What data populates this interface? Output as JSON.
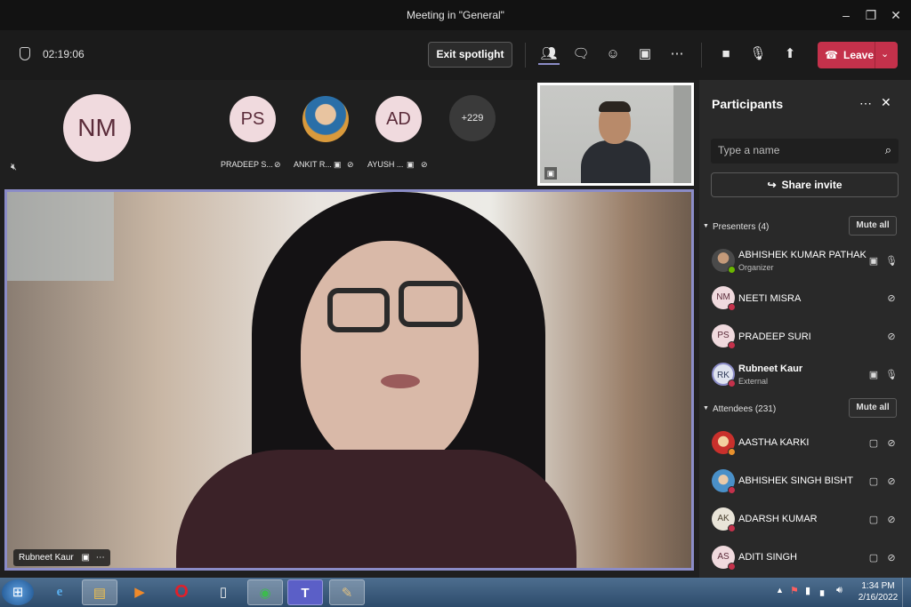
{
  "window": {
    "title": "Meeting in \"General\""
  },
  "toolbar": {
    "timer": "02:19:06",
    "exit_spotlight": "Exit spotlight",
    "leave": "Leave"
  },
  "stage": {
    "tiles": [
      {
        "initials": "NM",
        "name": ""
      },
      {
        "initials": "PS",
        "name": "PRADEEP S..."
      },
      {
        "initials": "",
        "name": "ANKIT R..."
      },
      {
        "initials": "AD",
        "name": "AYUSH ..."
      }
    ],
    "overflow": "+229",
    "spotlight_name": "Rubneet Kaur"
  },
  "panel": {
    "title": "Participants",
    "search_placeholder": "Type a name",
    "share_invite": "Share invite",
    "presenters_label": "Presenters (4)",
    "attendees_label": "Attendees (231)",
    "mute_all": "Mute all",
    "presenters": [
      {
        "initials": "",
        "name": "ABHISHEK KUMAR PATHAK",
        "role": "Organizer"
      },
      {
        "initials": "NM",
        "name": "NEETI MISRA",
        "role": ""
      },
      {
        "initials": "PS",
        "name": "PRADEEP SURI",
        "role": ""
      },
      {
        "initials": "RK",
        "name": "Rubneet Kaur",
        "role": "External"
      }
    ],
    "attendees": [
      {
        "initials": "",
        "name": "AASTHA KARKI"
      },
      {
        "initials": "",
        "name": "ABHISHEK SINGH BISHT"
      },
      {
        "initials": "AK",
        "name": "ADARSH KUMAR"
      },
      {
        "initials": "AS",
        "name": "ADITI SINGH"
      }
    ]
  },
  "taskbar": {
    "time": "1:34 PM",
    "date": "2/16/2022"
  }
}
